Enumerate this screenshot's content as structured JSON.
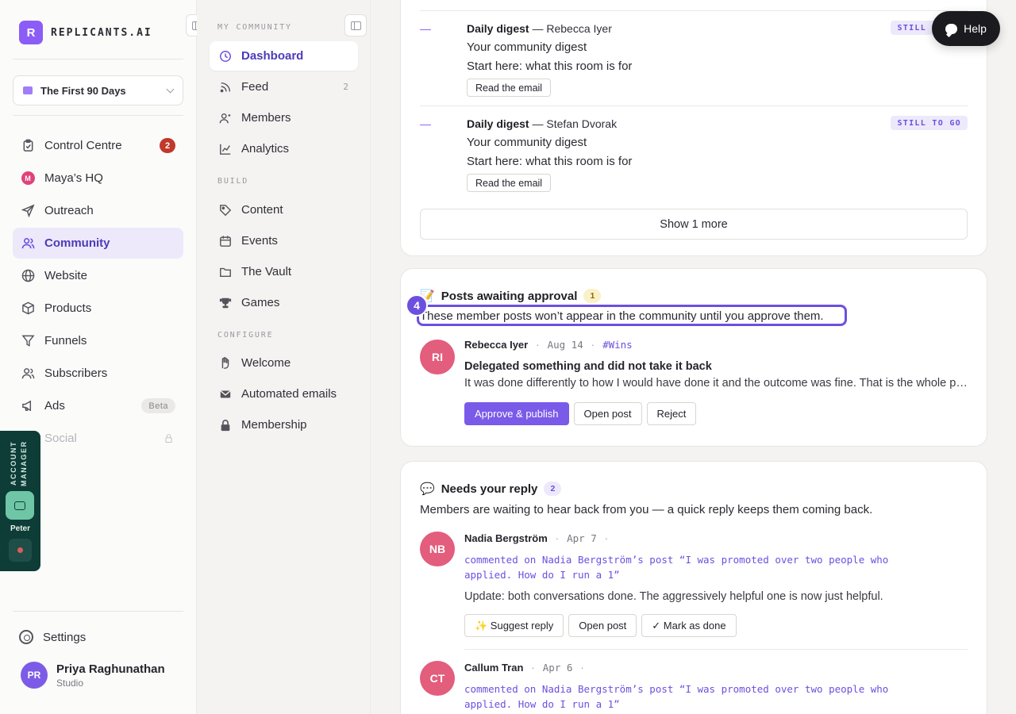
{
  "brand": {
    "logo_letter": "R",
    "name": "REPLICANTS.AI"
  },
  "workspace": {
    "name": "The First 90 Days"
  },
  "nav": [
    {
      "label": "Control Centre",
      "icon": "clipboard-icon",
      "badge": "2",
      "active": false
    },
    {
      "label": "Maya’s HQ",
      "icon": "maya-avatar-icon",
      "active": false
    },
    {
      "label": "Outreach",
      "icon": "send-icon",
      "active": false
    },
    {
      "label": "Community",
      "icon": "users-icon",
      "active": true
    },
    {
      "label": "Website",
      "icon": "globe-icon",
      "active": false
    },
    {
      "label": "Products",
      "icon": "box-icon",
      "active": false
    },
    {
      "label": "Funnels",
      "icon": "funnel-icon",
      "active": false
    },
    {
      "label": "Subscribers",
      "icon": "users-icon",
      "active": false
    },
    {
      "label": "Ads",
      "icon": "megaphone-icon",
      "badge": "Beta",
      "active": false
    },
    {
      "label": "Social",
      "icon": "lock-icon",
      "active": false,
      "disabled": true
    }
  ],
  "account_manager": {
    "title": "ACCOUNT MANAGER",
    "name": "Peter"
  },
  "settings_label": "Settings",
  "user": {
    "initials": "PR",
    "name": "Priya Raghunathan",
    "plan": "Studio"
  },
  "subnav": {
    "heading_community": "MY COMMUNITY",
    "heading_build": "BUILD",
    "heading_configure": "CONFIGURE",
    "community_items": [
      {
        "label": "Dashboard",
        "active": true
      },
      {
        "label": "Feed",
        "count": "2"
      },
      {
        "label": "Members"
      },
      {
        "label": "Analytics"
      }
    ],
    "build_items": [
      {
        "label": "Content"
      },
      {
        "label": "Events"
      },
      {
        "label": "The Vault"
      },
      {
        "label": "Games"
      }
    ],
    "configure_items": [
      {
        "label": "Welcome"
      },
      {
        "label": "Automated emails"
      },
      {
        "label": "Membership"
      }
    ]
  },
  "digests": [
    {
      "dash": "—",
      "type": "Daily digest",
      "author": "— Rebecca Iyer",
      "line1": "Your community digest",
      "line2": "Start here: what this room is for",
      "button": "Read the email",
      "status": "STILL TO GO"
    },
    {
      "dash": "—",
      "type": "Daily digest",
      "author": "— Stefan Dvorak",
      "line1": "Your community digest",
      "line2": "Start here: what this room is for",
      "button": "Read the email",
      "status": "STILL TO GO"
    }
  ],
  "show_more": "Show 1 more",
  "approval": {
    "emoji": "📝",
    "title": "Posts awaiting approval",
    "count": "1",
    "step": "4",
    "description": "These member posts won’t appear in the community until you approve them.",
    "post": {
      "initials": "RI",
      "author": "Rebecca Iyer",
      "date": "Aug 14",
      "tag": "#Wins",
      "title": "Delegated something and did not take it back",
      "body": "It was done differently to how I would have done it and the outcome was fine. That is the whole post. I am proud of myself.",
      "approve": "Approve & publish",
      "open": "Open post",
      "reject": "Reject"
    }
  },
  "replies": {
    "emoji": "💬",
    "title": "Needs your reply",
    "count": "2",
    "description": "Members are waiting to hear back from you — a quick reply keeps them coming back.",
    "items": [
      {
        "initials": "NB",
        "author": "Nadia Bergström",
        "date": "Apr 7",
        "comment": "commented on Nadia Bergström’s post “I was promoted over two people who applied. How do I run a 1”",
        "text": "Update: both conversations done. The aggressively helpful one is now just helpful.",
        "suggest": "✨ Suggest reply",
        "open": "Open post",
        "done": "✓ Mark as done"
      },
      {
        "initials": "CT",
        "author": "Callum Tran",
        "date": "Apr 6",
        "comment": "commented on Nadia Bergström’s post “I was promoted over two people who applied. How do I run a 1”"
      }
    ]
  },
  "help": {
    "label": "Help"
  },
  "colors": {
    "accent": "#6d4fe0",
    "brand": "#8b5cf6",
    "account_manager_bg": "#0e3c36"
  }
}
